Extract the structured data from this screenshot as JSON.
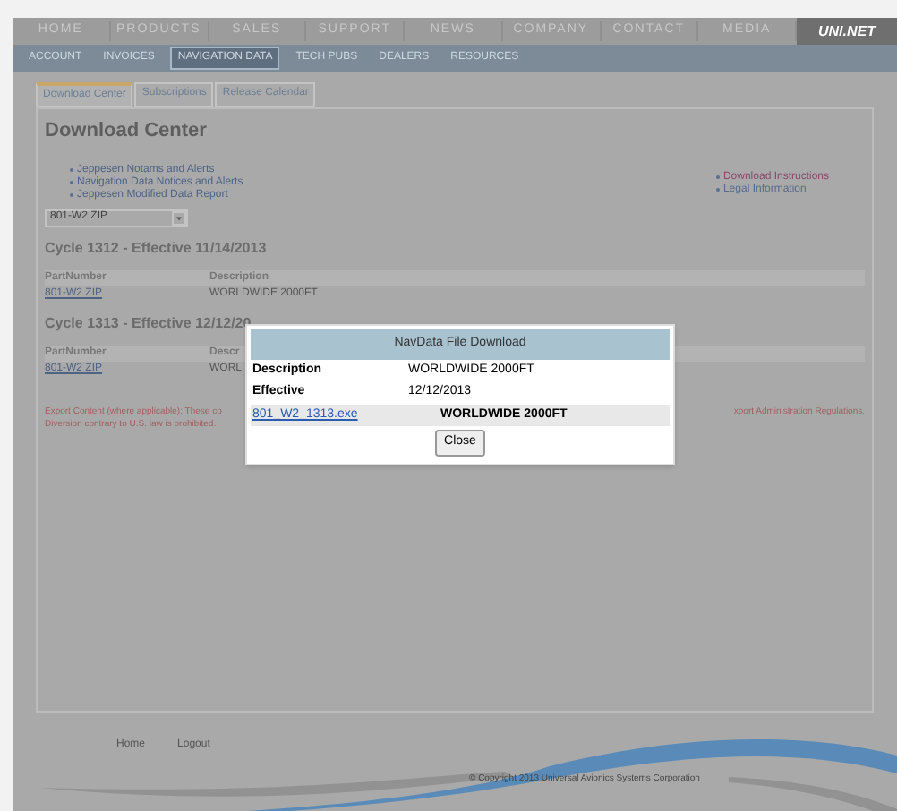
{
  "nav": [
    {
      "label": "HOME"
    },
    {
      "label": "PRODUCTS"
    },
    {
      "label": "SALES"
    },
    {
      "label": "SUPPORT"
    },
    {
      "label": "NEWS"
    },
    {
      "label": "COMPANY"
    },
    {
      "label": "CONTACT"
    },
    {
      "label": "MEDIA"
    }
  ],
  "logo": "UNI.NET",
  "subnav": [
    {
      "label": "ACCOUNT",
      "selected": false
    },
    {
      "label": "INVOICES",
      "selected": false
    },
    {
      "label": "NAVIGATION DATA",
      "selected": true
    },
    {
      "label": "TECH PUBS",
      "selected": false
    },
    {
      "label": "DEALERS",
      "selected": false
    },
    {
      "label": "RESOURCES",
      "selected": false
    }
  ],
  "tabs": [
    {
      "label": "Download Center",
      "selected": true
    },
    {
      "label": "Subscriptions",
      "selected": false
    },
    {
      "label": "Release Calendar",
      "selected": false
    }
  ],
  "heading": "Download Center",
  "left_links": [
    "Jeppesen Notams and Alerts",
    "Navigation Data Notices and Alerts",
    "Jeppesen Modified Data Report"
  ],
  "right_links": [
    {
      "label": "Download Instructions",
      "color": "#8a4a6a"
    },
    {
      "label": "Legal Information",
      "color": "#5a6a8a"
    }
  ],
  "select": {
    "value": "801-W2 ZIP"
  },
  "cycles": [
    {
      "title": "Cycle 1312 - Effective 11/14/2013",
      "columns": [
        "PartNumber",
        "Description"
      ],
      "rows": [
        [
          "801-W2 ZIP",
          "WORLDWIDE 2000FT"
        ]
      ]
    },
    {
      "title": "Cycle 1313 - Effective 12/12/20",
      "columns": [
        "PartNumber",
        "Descr"
      ],
      "rows": [
        [
          "801-W2 ZIP",
          "WORL"
        ]
      ]
    }
  ],
  "export_notice": {
    "left": [
      "Export Content (where applicable): These co",
      "Diversion contrary to U.S. law is prohibited."
    ],
    "right": "xport Administration Regulations."
  },
  "footer": {
    "links": [
      "Home",
      "Logout"
    ],
    "copyright": "© Copyright 2013 Universal Avionics Systems Corporation"
  },
  "dialog": {
    "title": "NavData File Download",
    "fields": [
      {
        "label": "Description",
        "value": "WORLDWIDE 2000FT"
      },
      {
        "label": "Effective",
        "value": "12/12/2013"
      }
    ],
    "file": {
      "link": "801_W2_1313.exe",
      "description": "WORLDWIDE 2000FT"
    },
    "button": "Close"
  }
}
